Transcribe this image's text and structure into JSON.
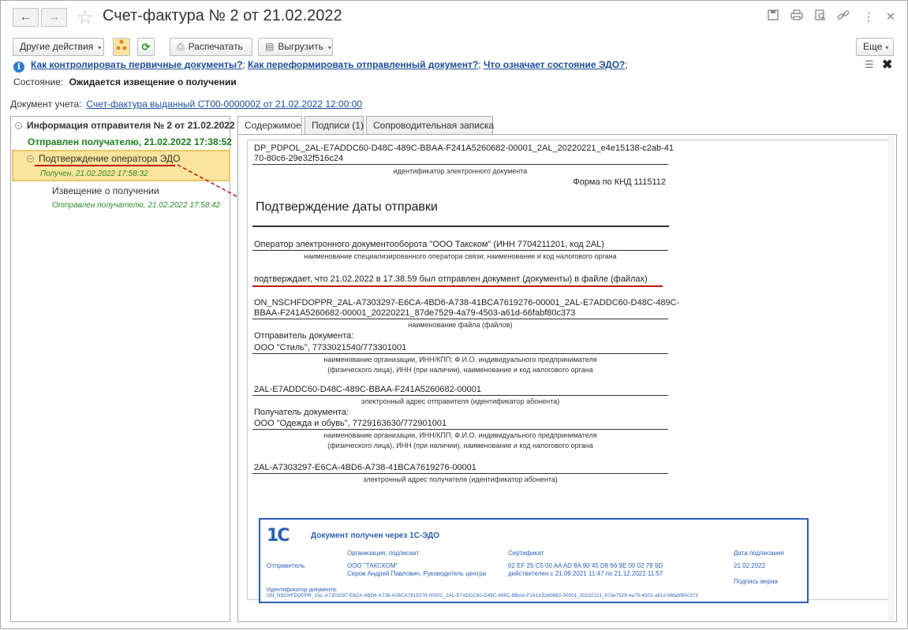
{
  "window": {
    "title": "Счет-фактура № 2 от 21.02.2022",
    "back_icon": "arrow-left-icon",
    "forward_icon": "arrow-right-icon"
  },
  "toolbar": {
    "other_actions": "Другие действия",
    "print": "Распечатать",
    "export": "Выгрузить",
    "more": "Еще"
  },
  "help_links": [
    "Как контролировать первичные документы?",
    "Как переформировать отправленный документ?",
    "Что означает состояние ЭДО?"
  ],
  "status": {
    "label": "Состояние:",
    "value": "Ожидается извещение о получении"
  },
  "account_doc": {
    "label": "Документ учета:",
    "link": "Счет-фактура выданный СТ00-0000002 от 21.02.2022 12:00:00"
  },
  "tree": {
    "root": "Информация отправителя № 2 от 21.02.2022",
    "root_status": "Отправлен получателю, 21.02.2022 17:38:52",
    "child": "Подтверждение оператора ЭДО",
    "child_status": "Получен, 21.02.2022 17:58:32",
    "leaf": "Извещение о получении",
    "leaf_status": "Отправлен получателю, 21.02.2022 17:58:42"
  },
  "tabs": [
    "Содержимое",
    "Подписи (1)",
    "Сопроводительная записка"
  ],
  "document": {
    "id_line1": "DP_PDPOL_2AL-E7ADDC60-D48C-489C-BBAA-F241A5260682-00001_2AL_20220221_e4e15138-c2ab-41",
    "id_line2": "70-80c6-29e32f516c24",
    "id_caption": "идентификатор электронного документа",
    "form": "Форма по КНД 1115112",
    "heading": "Подтверждение даты отправки",
    "operator": "Оператор электронного документооборота \"ООО Такском\" (ИНН 7704211201, код 2AL)",
    "operator_caption": "наименование специализированного оператора связи; наименование и код налогового органа",
    "confirm": "подтверждает, что 21.02.2022 в 17.38.59 был отправлен документ (документы) в файле (файлах)",
    "file_line1": "ON_NSCHFDOPPR_2AL-A7303297-E6CA-4BD6-A738-41BCA7619276-00001_2AL-E7ADDC60-D48C-489C-",
    "file_line2": "BBAA-F241A5260682-00001_20220221_87de7529-4a79-4503-a61d-66fabf80c373",
    "file_caption": "наименование файла (файлов)",
    "sender_label": "Отправитель документа:",
    "sender": "ООО \"Стиль\", 7733021540/773301001",
    "org_caption1": "наименование организации, ИНН/КПП; Ф.И.О. индивидуального предпринимателя",
    "org_caption2": "(физического лица), ИНН (при наличии), наименование и код налогового органа",
    "sender_addr": "2AL-E7ADDC60-D48C-489C-BBAA-F241A5260682-00001",
    "sender_addr_caption": "электронный адрес отправителя (идентификатор абонента)",
    "receiver_label": "Получатель документа:",
    "receiver": "ООО \"Одежда и обувь\", 7729163630/772901001",
    "receiver_addr": "2AL-A7303297-E6CA-4BD6-A738-41BCA7619276-00001",
    "receiver_addr_caption": "электронный адрес получателя (идентификатор абонента)"
  },
  "stamp": {
    "logo": "1С",
    "title": "Документ получен через 1С-ЭДО",
    "col_org": "Организация, подписант",
    "col_cert": "Сертификат",
    "col_date": "Дата подписания",
    "role": "Отправитель",
    "org": "ООО \"ТАКСКОМ\"",
    "signer": "Серов Андрей Павлович, Руководитель центра",
    "cert": "02 EF 25 C5 00 AA AD 8A 90 45 D8 66 9E 00 02 78 9D",
    "cert_valid": "действителен с 21.09.2021 11:47 по 21.12.2022 11:57",
    "date": "21.02.2022",
    "sign_ok": "Подпись верна",
    "id_label": "Идентификатор документа:",
    "id_value": "ON_NSCHFDOPPR_2AL-A7303297-E6CA-4BD6-A738-41BCA7619276-00001_2AL-E7ADDC60-D48C-489C-BBAA-F241A5260682-00001_20220221_87de7529-4a79-4503-a61d-66fabf80c373"
  },
  "colors": {
    "accent_link": "#1a4e9a",
    "green_status": "#1e7d1e",
    "selection": "#fbe49b",
    "red_annotation": "#c21616",
    "stamp_blue": "#2b5fb4"
  }
}
